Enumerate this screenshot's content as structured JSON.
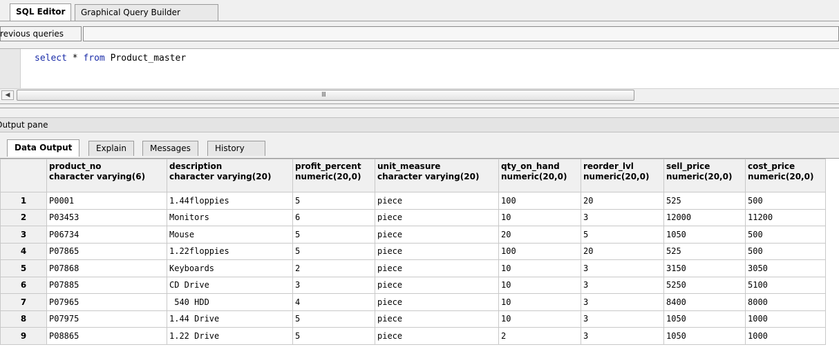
{
  "top_tabs": [
    "SQL Editor",
    "Graphical Query Builder"
  ],
  "previous_queries_label": "Previous queries",
  "editor": {
    "kw_select": "select",
    "star": " * ",
    "kw_from": "from",
    "table_name": " Product_master"
  },
  "scrollbar_grip": "III",
  "scroll_left_glyph": "◀",
  "output_pane_label": "Output pane",
  "output_tabs": [
    "Data Output",
    "Explain",
    "Messages",
    "History"
  ],
  "grid": {
    "columns": [
      {
        "name": "product_no",
        "type": "character varying(6)"
      },
      {
        "name": "description",
        "type": "character varying(20)"
      },
      {
        "name": "profit_percent",
        "type": "numeric(20,0)"
      },
      {
        "name": "unit_measure",
        "type": "character varying(20)"
      },
      {
        "name": "qty_on_hand",
        "type": "numeric(20,0)"
      },
      {
        "name": "reorder_lvl",
        "type": "numeric(20,0)"
      },
      {
        "name": "sell_price",
        "type": "numeric(20,0)"
      },
      {
        "name": "cost_price",
        "type": "numeric(20,0)"
      }
    ],
    "rows": [
      {
        "n": "1",
        "cells": [
          "P0001",
          "1.44floppies",
          "5",
          "piece",
          "100",
          "20",
          "525",
          "500"
        ]
      },
      {
        "n": "2",
        "cells": [
          "P03453",
          "Monitors",
          "6",
          "piece",
          "10",
          "3",
          "12000",
          "11200"
        ]
      },
      {
        "n": "3",
        "cells": [
          "P06734",
          "Mouse",
          "5",
          "piece",
          "20",
          "5",
          "1050",
          "500"
        ]
      },
      {
        "n": "4",
        "cells": [
          "P07865",
          "1.22floppies",
          "5",
          "piece",
          "100",
          "20",
          "525",
          "500"
        ]
      },
      {
        "n": "5",
        "cells": [
          "P07868",
          "Keyboards",
          "2",
          "piece",
          "10",
          "3",
          "3150",
          "3050"
        ]
      },
      {
        "n": "6",
        "cells": [
          "P07885",
          "CD Drive",
          "3",
          "piece",
          "10",
          "3",
          "5250",
          "5100"
        ]
      },
      {
        "n": "7",
        "cells": [
          "P07965",
          " 540 HDD",
          "4",
          "piece",
          "10",
          "3",
          "8400",
          "8000"
        ]
      },
      {
        "n": "8",
        "cells": [
          "P07975",
          "1.44 Drive",
          "5",
          "piece",
          "10",
          "3",
          "1050",
          "1000"
        ]
      },
      {
        "n": "9",
        "cells": [
          "P08865",
          "1.22 Drive",
          "5",
          "piece",
          "2",
          "3",
          "1050",
          "1000"
        ]
      }
    ]
  }
}
